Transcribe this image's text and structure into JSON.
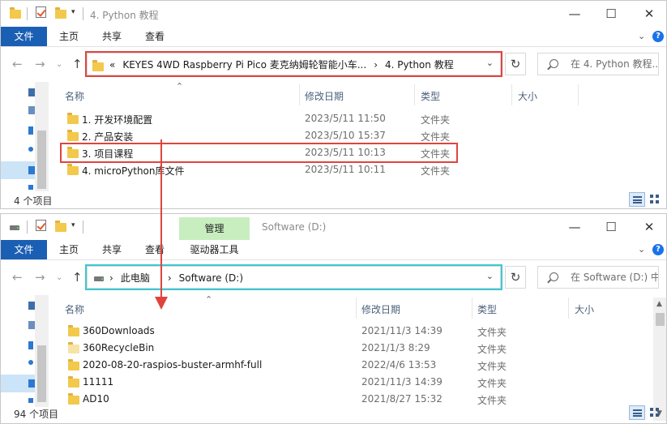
{
  "colors": {
    "highlight_red": "#e0443f",
    "highlight_cyan": "#3cc8d2",
    "ribbon_file": "#1a5fb4",
    "manage_tab": "#c8eec0"
  },
  "window1": {
    "title": "4. Python 教程",
    "ribbon": {
      "file": "文件",
      "home": "主页",
      "share": "共享",
      "view": "查看"
    },
    "breadcrumb": {
      "overflow": "«",
      "item1": "KEYES 4WD Raspberry Pi Pico 麦克纳姆轮智能小车...",
      "sep": "›",
      "item2": "4. Python 教程"
    },
    "search_placeholder": "在 4. Python 教程...",
    "columns": {
      "name": "名称",
      "date": "修改日期",
      "type": "类型",
      "size": "大小"
    },
    "rows": [
      {
        "name": "1. 开发环境配置",
        "date": "2023/5/11 11:50",
        "type": "文件夹"
      },
      {
        "name": "2. 产品安装",
        "date": "2023/5/10 15:37",
        "type": "文件夹"
      },
      {
        "name": "3. 项目课程",
        "date": "2023/5/11 10:13",
        "type": "文件夹"
      },
      {
        "name": "4. microPython库文件",
        "date": "2023/5/11 10:11",
        "type": "文件夹"
      }
    ],
    "status": "4 个项目"
  },
  "window2": {
    "title": "Software (D:)",
    "ribbon": {
      "file": "文件",
      "home": "主页",
      "share": "共享",
      "view": "查看",
      "manage": "管理",
      "drive_tools": "驱动器工具"
    },
    "breadcrumb": {
      "sep": "›",
      "item1": "此电脑",
      "item2": "Software (D:)"
    },
    "search_placeholder": "在 Software (D:) 中...",
    "columns": {
      "name": "名称",
      "date": "修改日期",
      "type": "类型",
      "size": "大小"
    },
    "rows": [
      {
        "name": "360Downloads",
        "date": "2021/11/3 14:39",
        "type": "文件夹"
      },
      {
        "name": "360RecycleBin",
        "date": "2021/1/3 8:29",
        "type": "文件夹"
      },
      {
        "name": "2020-08-20-raspios-buster-armhf-full",
        "date": "2022/4/6 13:53",
        "type": "文件夹"
      },
      {
        "name": "11111",
        "date": "2021/11/3 14:39",
        "type": "文件夹"
      },
      {
        "name": "AD10",
        "date": "2021/8/27 15:32",
        "type": "文件夹"
      }
    ],
    "status": "94 个项目"
  },
  "icons": {
    "folder": "folder-icon",
    "back": "back-arrow-icon",
    "forward": "forward-arrow-icon",
    "up": "up-arrow-icon",
    "refresh": "refresh-icon",
    "search": "search-icon",
    "minimize": "minimize-icon",
    "maximize": "maximize-icon",
    "close": "close-icon",
    "drive": "drive-icon"
  }
}
